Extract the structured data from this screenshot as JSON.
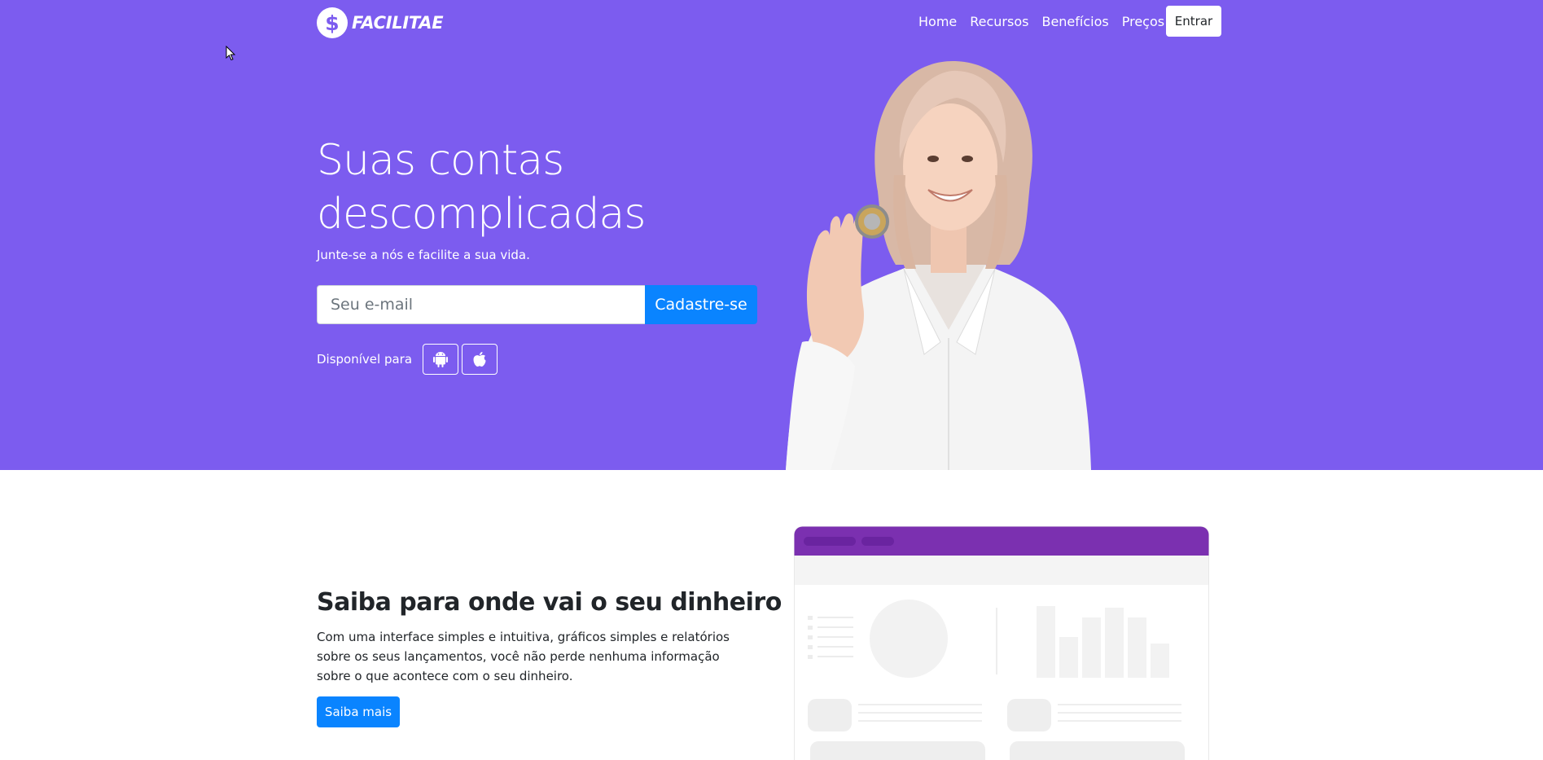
{
  "brand": {
    "name": "FACILITAE",
    "symbol": "$"
  },
  "nav": {
    "links": [
      "Home",
      "Recursos",
      "Benefícios",
      "Preços"
    ],
    "login_label": "Entrar"
  },
  "hero": {
    "title_line1": "Suas contas",
    "title_line2": "descomplicadas",
    "subtitle": "Junte-se a nós e facilite a sua vida.",
    "email_placeholder": "Seu e-mail",
    "email_value": "",
    "signup_label": "Cadastre-se",
    "available_label": "Disponível para",
    "stores": [
      "android-icon",
      "apple-icon"
    ]
  },
  "feature": {
    "title": "Saiba para onde vai o seu dinheiro",
    "text": "Com uma interface simples e intuitiva, gráficos simples e relatórios sobre os seus lançamentos, você não perde nenhuma informação sobre o que acontece com o seu dinheiro.",
    "button_label": "Saiba mais"
  },
  "colors": {
    "hero_bg": "#7c5cef",
    "primary": "#0a84ff",
    "mockup_header": "#7b30b0"
  }
}
